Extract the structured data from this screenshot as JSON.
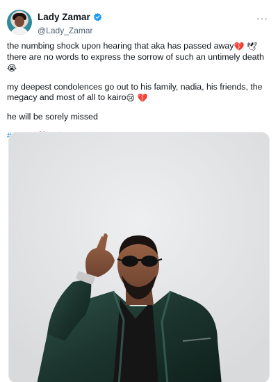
{
  "tweet": {
    "display_name": "Lady Zamar",
    "handle": "@Lady_Zamar",
    "more_label": "···",
    "paragraph1_text": "the numbing shock upon hearing that aka has passed away",
    "paragraph1_emoji1": "💔",
    "paragraph1_emoji2": "🕊",
    "paragraph1_text2": "there are no words to express the sorrow of such an untimely death",
    "paragraph1_emoji3": "😭",
    "paragraph2_text": "my deepest condolences go out to his family, nadia, his friends, the megacy and most of all to kairo",
    "paragraph2_emoji1": "😢",
    "paragraph2_emoji2": "💔",
    "paragraph3_text": "he will be sorely missed",
    "hashtag": "#ripaka",
    "hashtag_emoji1": "💐",
    "hashtag_emoji2": "🕊"
  },
  "icons": {
    "verified": "verified-badge-icon",
    "more": "more-options-icon"
  },
  "colors": {
    "link": "#1d9bf0",
    "text": "#0f1419",
    "secondary": "#536471",
    "media_bg": "#e4e5e7",
    "jacket": "#1f3a33"
  }
}
